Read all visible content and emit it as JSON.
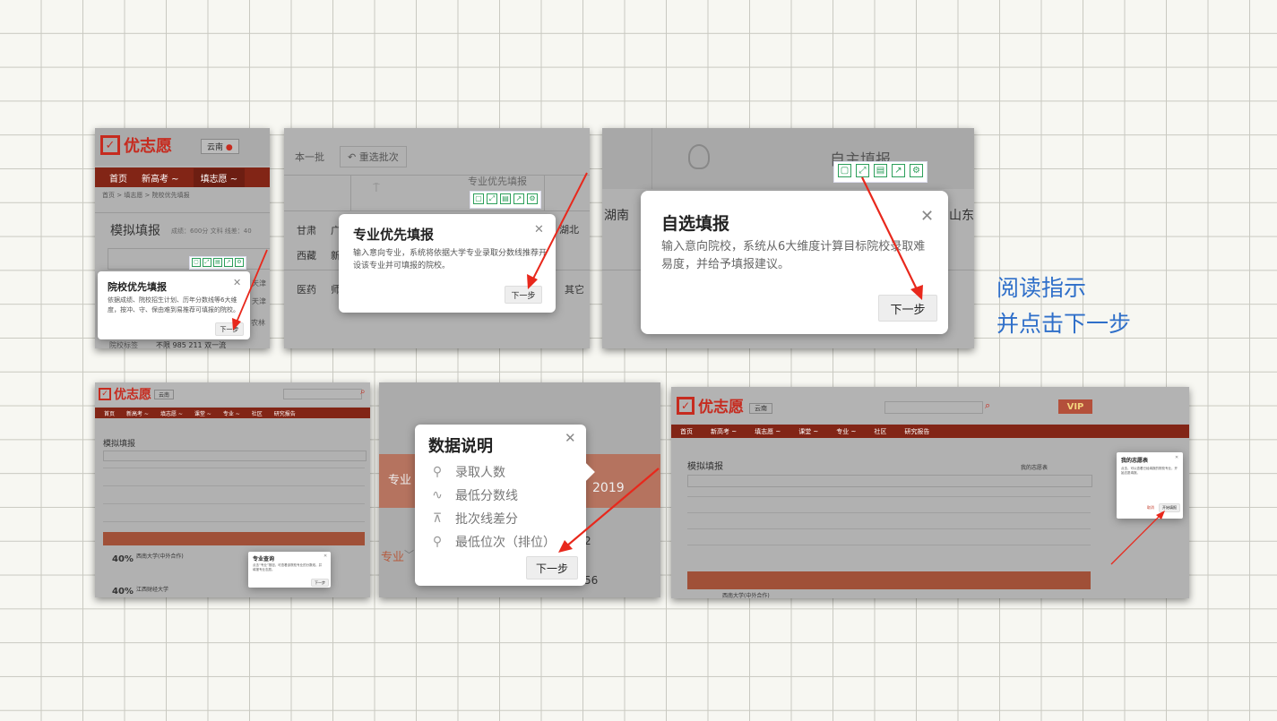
{
  "colors": {
    "accent": "#c03523",
    "toolbar_green": "#2c9f5b",
    "arrow": "#e8281c",
    "instruction": "#2f6fc9"
  },
  "instruction": {
    "line1": "阅读指示",
    "line2": "并点击下一步"
  },
  "toolbar_icons": [
    "note-icon",
    "expand-icon",
    "save-icon",
    "share-icon",
    "settings-icon"
  ],
  "shot1": {
    "logo": "优志愿",
    "region": "云南",
    "nav": [
      "首页",
      "新高考 ~",
      "填志愿 ~"
    ],
    "breadcrumb": "首页 > 填志愿 > 院校优先填报",
    "title": "模拟填报",
    "score": "成绩：600分 文科  线差：40",
    "filter_row": "不限 985 211 双一流",
    "filter_label": "院校标签",
    "modal": {
      "title": "院校优先填报",
      "desc": "依据成绩、院校招生计划、历年分数线等6大维度，按冲、守、保由难到易推荐可填报的院校。",
      "button": "下一步"
    },
    "side_texts": [
      "天津",
      "天津",
      "农林"
    ]
  },
  "shot2": {
    "batch": "本一批",
    "reselect": "重选批次",
    "tab": "专业优先填报",
    "rows": [
      [
        "甘肃",
        "广"
      ],
      [
        "西藏",
        "新"
      ],
      [
        "医药",
        "师"
      ]
    ],
    "right_texts": [
      "湖北",
      "其它"
    ],
    "modal": {
      "title": "专业优先填报",
      "desc": "输入意向专业，系统将依据大学专业录取分数线推荐开设该专业并可填报的院校。",
      "button": "下一步"
    }
  },
  "shot3": {
    "bg_title": "自主填报",
    "left_text": "湖南",
    "right_text": "山东",
    "modal": {
      "title": "自选填报",
      "desc": "输入意向院校，系统从6大维度计算目标院校录取难易度，并给予填报建议。",
      "button": "下一步"
    }
  },
  "shot4": {
    "logo": "优志愿",
    "region": "云南",
    "nav": [
      "首页",
      "新高考 ~",
      "填志愿 ~",
      "课堂 ~",
      "专业 ~",
      "社区",
      "研究报告"
    ],
    "title": "模拟填报",
    "pcts": [
      "40%",
      "40%"
    ],
    "schools": [
      "西南大学(中外合作)",
      "江西财经大学"
    ],
    "modal": {
      "title": "专业查询",
      "desc": "点击“专业”按钮，可查看该院校专业的分数线，并填报专业志愿。",
      "button": "下一步"
    }
  },
  "shot5": {
    "modal": {
      "title": "数据说明",
      "items": [
        {
          "icon": "person-icon",
          "label": "录取人数"
        },
        {
          "icon": "trend-icon",
          "label": "最低分数线"
        },
        {
          "icon": "batch-line-icon",
          "label": "批次线差分"
        },
        {
          "icon": "location-pin-icon",
          "label": "最低位次（排位）"
        }
      ],
      "button": "下一步"
    },
    "bg": {
      "left_label": "专业",
      "year": "2019",
      "major_link": "专业",
      "num1": "2",
      "num2": "56"
    }
  },
  "shot6": {
    "logo": "优志愿",
    "region": "云南",
    "nav": [
      "首页",
      "新高考 ~",
      "填志愿 ~",
      "课堂 ~",
      "专业 ~",
      "社区",
      "研究报告"
    ],
    "title": "模拟填报",
    "wish_label": "我的志愿表",
    "vip": "VIP",
    "school": "西南大学(中外合作)",
    "modal": {
      "title": "我的志愿表",
      "desc": "点击，可以查看已经填报的院校专业，开始志愿填报。",
      "cancel": "取消",
      "button": "开始填报"
    }
  }
}
